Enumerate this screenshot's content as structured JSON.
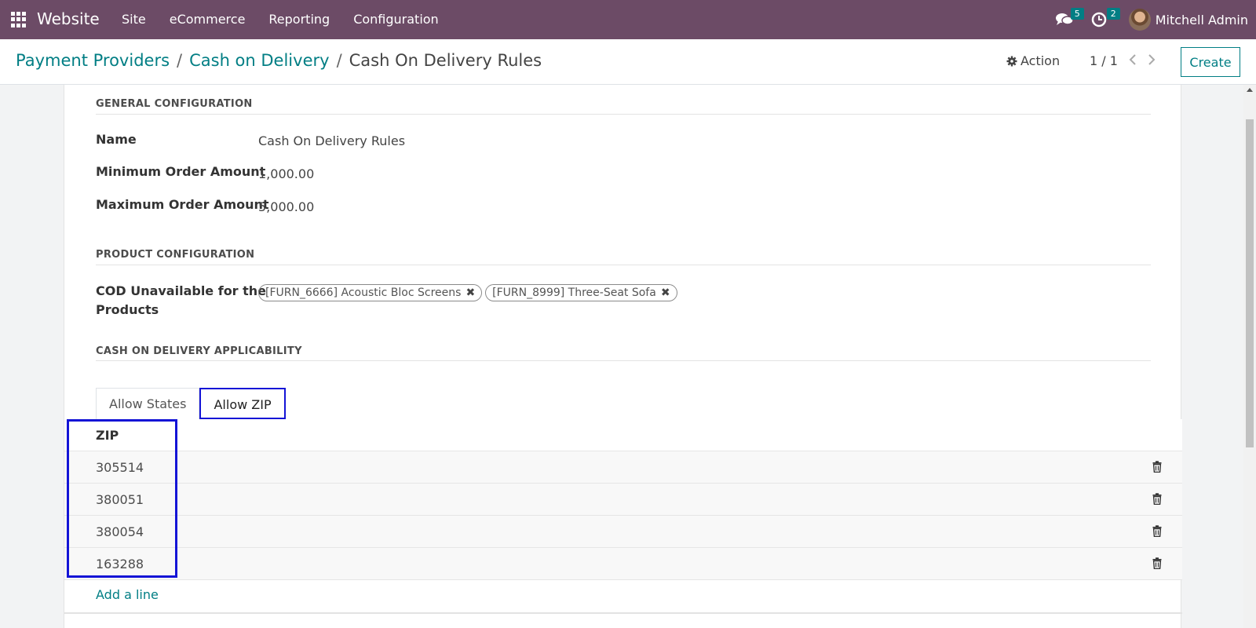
{
  "navbar": {
    "app_name": "Website",
    "menu": [
      "Site",
      "eCommerce",
      "Reporting",
      "Configuration"
    ],
    "messages_count": "5",
    "activities_count": "2",
    "user_name": "Mitchell Admin"
  },
  "control_panel": {
    "breadcrumb": [
      "Payment Providers",
      "Cash on Delivery",
      "Cash On Delivery Rules"
    ],
    "action_label": "Action",
    "pager": "1 / 1",
    "create_label": "Create"
  },
  "form": {
    "general_section": "GENERAL CONFIGURATION",
    "name_label": "Name",
    "name_value": "Cash On Delivery Rules",
    "min_label": "Minimum Order Amount",
    "min_value": "1,000.00",
    "max_label": "Maximum Order Amount",
    "max_value": "5,000.00",
    "product_section": "PRODUCT CONFIGURATION",
    "products_label_line1": "COD Unavailable for the",
    "products_label_line2": "Products",
    "products": [
      "[FURN_6666] Acoustic Bloc Screens",
      "[FURN_8999] Three-Seat Sofa"
    ],
    "applicability_section": "CASH ON DELIVERY APPLICABILITY",
    "tabs": [
      "Allow States",
      "Allow ZIP"
    ],
    "zip_header": "ZIP",
    "zips": [
      "305514",
      "380051",
      "380054",
      "163288"
    ],
    "add_line": "Add a line"
  },
  "colors": {
    "navbar": "#6c4b66",
    "accent": "#017e84",
    "highlight": "#1414d6"
  }
}
